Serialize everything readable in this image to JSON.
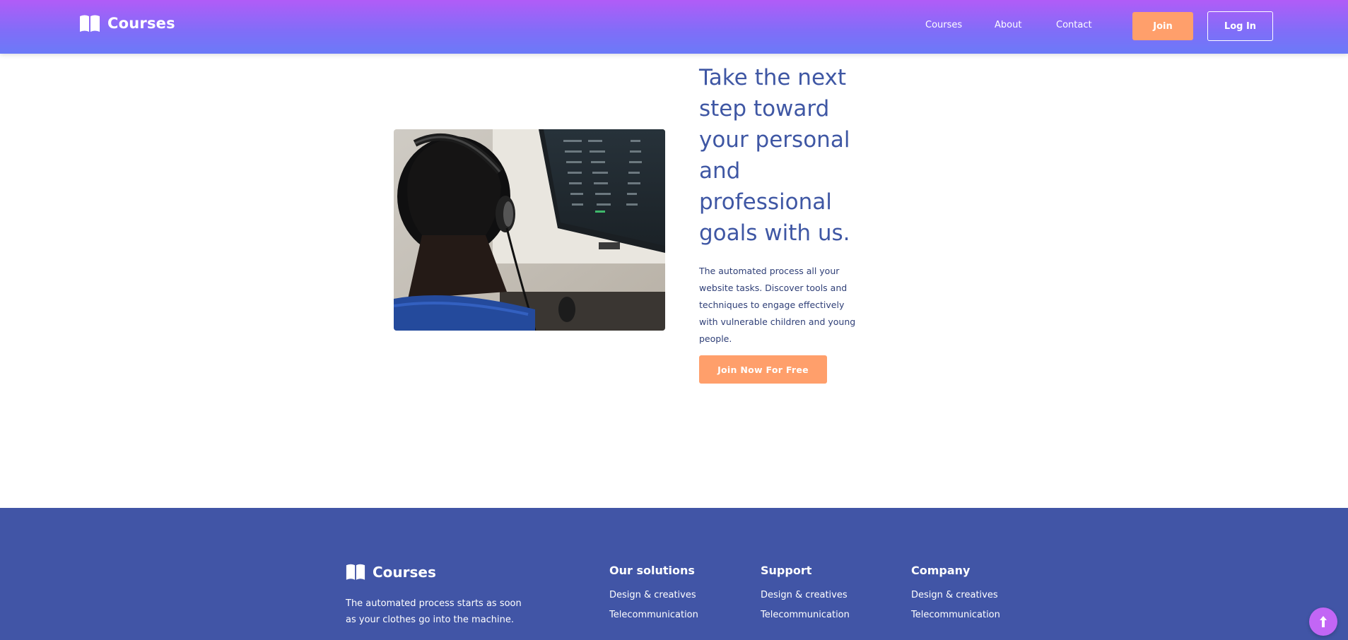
{
  "header": {
    "brand": "Courses",
    "nav": [
      "Courses",
      "About",
      "Contact"
    ],
    "join_label": "Join",
    "login_label": "Log In"
  },
  "hero": {
    "title": "Take the next step toward your personal and professional goals with us.",
    "text": "The automated process all your website tasks. Discover tools and techniques to engage effectively with vulnerable children and young people.",
    "cta_label": "Join Now For Free"
  },
  "footer": {
    "brand": "Courses",
    "description": "The automated process starts as soon as your clothes go into the machine.",
    "columns": [
      {
        "title": "Our solutions",
        "items": [
          "Design & creatives",
          "Telecommunication"
        ]
      },
      {
        "title": "Support",
        "items": [
          "Design & creatives",
          "Telecommunication"
        ]
      },
      {
        "title": "Company",
        "items": [
          "Design & creatives",
          "Telecommunication"
        ]
      }
    ]
  },
  "colors": {
    "header_gradient_top": "#b15cf7",
    "header_gradient_bottom": "#6b7af8",
    "accent_orange": "#ff9f6b",
    "heading_blue": "#3f57a4",
    "footer_bg": "#4155a6"
  },
  "icons": [
    "book-icon",
    "arrow-up-icon"
  ]
}
